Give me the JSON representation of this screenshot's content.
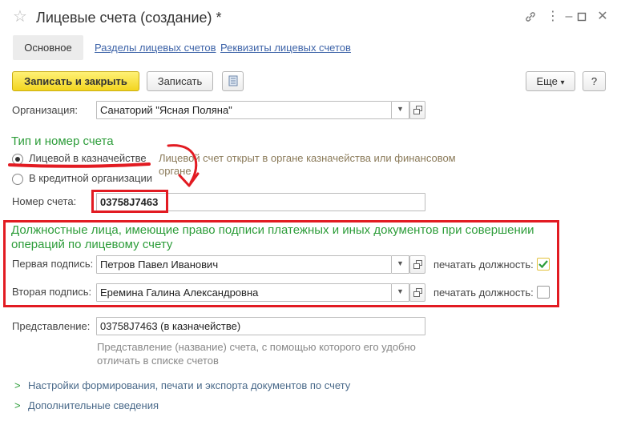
{
  "window": {
    "title": "Лицевые счета (создание) *"
  },
  "tabs": [
    {
      "label": "Основное"
    },
    {
      "label": "Разделы лицевых счетов"
    },
    {
      "label": "Реквизиты лицевых счетов"
    }
  ],
  "toolbar": {
    "save_close": "Записать и закрыть",
    "save": "Записать",
    "more": "Еще",
    "more_arrow": "▾",
    "help": "?"
  },
  "organization": {
    "label": "Организация:",
    "value": "Санаторий \"Ясная Поляна\""
  },
  "account_type": {
    "title": "Тип и номер счета",
    "option_treasury": "Лицевой в казначействе",
    "option_credit": "В кредитной организации",
    "hint_line1": "Лицевой счет открыт в органе казначейства или финансовом",
    "hint_line2": "органе",
    "number_label": "Номер счета:",
    "number_value": "03758J7463"
  },
  "signatures": {
    "title_line1": "Должностные лица, имеющие право подписи платежных и иных документов при совершении",
    "title_line2": "операций по лицевому счету",
    "first_label": "Первая подпись:",
    "first_value": "Петров Павел Иванович",
    "first_print_label": "печатать должность:",
    "first_print_checked": true,
    "second_label": "Вторая подпись:",
    "second_value": "Еремина Галина Александровна",
    "second_print_label": "печатать должность:",
    "second_print_checked": false
  },
  "presentation": {
    "label": "Представление:",
    "value": "03758J7463 (в казначействе)",
    "hint_line1": "Представление (название) счета, с помощью которого его удобно",
    "hint_line2": "отличать в списке счетов"
  },
  "sections": [
    {
      "label": "Настройки формирования, печати и экспорта документов по счету"
    },
    {
      "label": "Дополнительные сведения"
    }
  ]
}
